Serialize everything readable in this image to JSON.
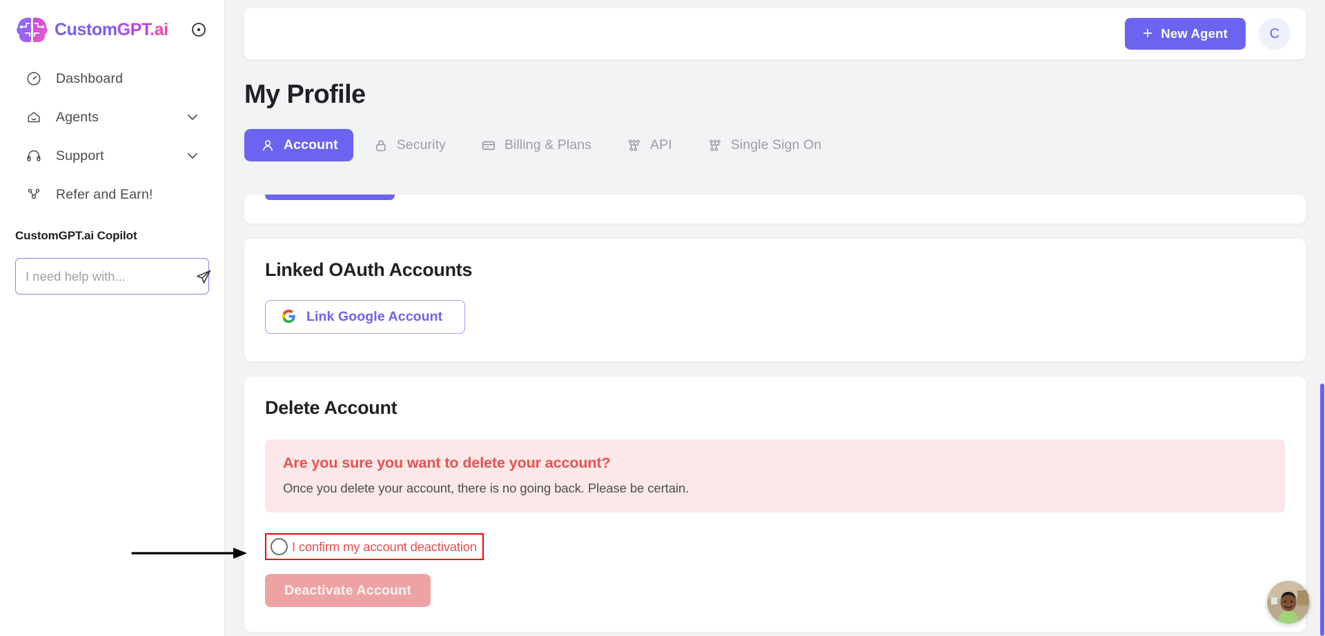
{
  "brand": {
    "name_part1": "Custom",
    "name_part2": "GPT",
    "name_part3": ".ai",
    "logo_icon": "brain-icon",
    "collapse_icon": "circle-dot-collapse-icon"
  },
  "sidebar": {
    "items": [
      {
        "label": "Dashboard",
        "icon": "speedometer-icon",
        "has_chevron": false
      },
      {
        "label": "Agents",
        "icon": "home-agent-icon",
        "has_chevron": true
      },
      {
        "label": "Support",
        "icon": "headset-icon",
        "has_chevron": true
      },
      {
        "label": "Refer and Earn!",
        "icon": "share-nodes-icon",
        "has_chevron": false
      }
    ],
    "copilot": {
      "title": "CustomGPT.ai Copilot",
      "input_value": "",
      "placeholder": "I need help with...",
      "send_icon": "send-paper-plane-icon"
    }
  },
  "topbar": {
    "new_agent_label": "New Agent",
    "plus_icon": "plus-icon",
    "avatar_initial": "C"
  },
  "page": {
    "title": "My Profile"
  },
  "tabs": [
    {
      "label": "Account",
      "icon": "user-icon",
      "active": true
    },
    {
      "label": "Security",
      "icon": "lock-icon",
      "active": false
    },
    {
      "label": "Billing & Plans",
      "icon": "credit-card-icon",
      "active": false
    },
    {
      "label": "API",
      "icon": "nodes-icon",
      "active": false
    },
    {
      "label": "Single Sign On",
      "icon": "nodes-icon",
      "active": false
    }
  ],
  "oauth_card": {
    "heading": "Linked OAuth Accounts",
    "google_button_label": "Link Google Account",
    "google_icon": "google-g-icon"
  },
  "delete_card": {
    "heading": "Delete Account",
    "warning_title": "Are you sure you want to delete your account?",
    "warning_subtitle": "Once you delete your account, there is no going back. Please be certain.",
    "confirm_checkbox_label": "I confirm my account deactivation",
    "confirm_checked": false,
    "deactivate_button_label": "Deactivate Account",
    "deactivate_disabled": true
  },
  "annotation": {
    "highlight_color": "#ff0000",
    "arrow_icon": "pointer-arrow-icon"
  },
  "chat_widget": {
    "avatar_icon": "support-person-avatar"
  },
  "colors": {
    "accent_purple": "#6c63f0",
    "danger_red": "#e8504f",
    "warning_bg": "#fce8e8",
    "page_bg": "#f2f3f4"
  },
  "scrollbar": {
    "thumb_color": "#6c63f0"
  }
}
